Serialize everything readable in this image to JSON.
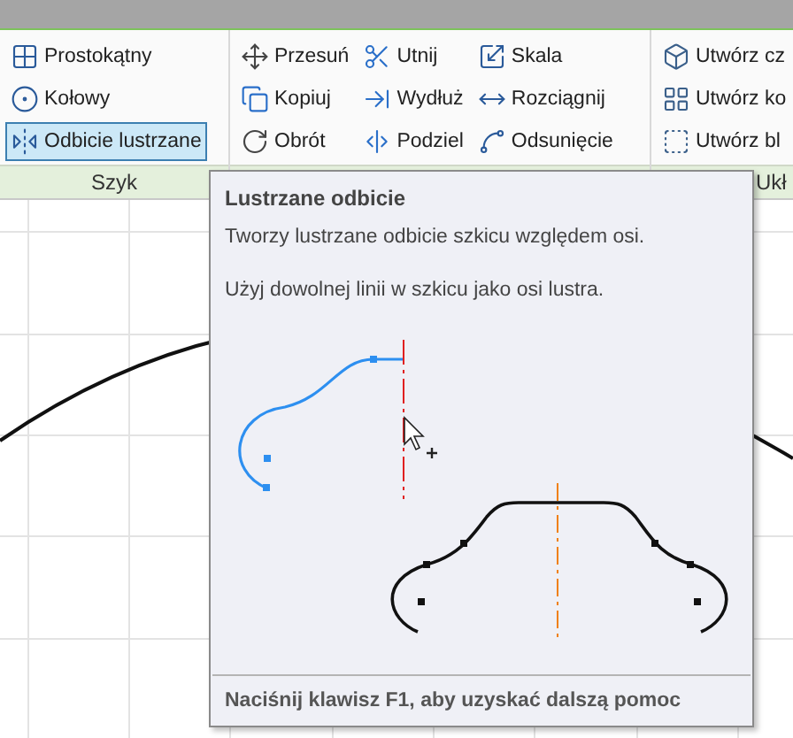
{
  "ribbon": {
    "groups": [
      {
        "label": "Szyk",
        "columns": [
          [
            {
              "label": "Prostokątny",
              "selected": false
            },
            {
              "label": "Kołowy",
              "selected": false
            },
            {
              "label": "Odbicie lustrzane",
              "selected": true
            }
          ]
        ]
      },
      {
        "columns": [
          [
            {
              "label": "Przesuń",
              "selected": false
            },
            {
              "label": "Kopiuj",
              "selected": false
            },
            {
              "label": "Obrót",
              "selected": false
            }
          ],
          [
            {
              "label": "Utnij",
              "selected": false
            },
            {
              "label": "Wydłuż",
              "selected": false
            },
            {
              "label": "Podziel",
              "selected": false
            }
          ],
          [
            {
              "label": "Skala",
              "selected": false
            },
            {
              "label": "Rozciągnij",
              "selected": false
            },
            {
              "label": "Odsunięcie",
              "selected": false
            }
          ]
        ]
      },
      {
        "label": "Ukł",
        "columns": [
          [
            {
              "label": "Utwórz cz",
              "selected": false
            },
            {
              "label": "Utwórz ko",
              "selected": false
            },
            {
              "label": "Utwórz bl",
              "selected": false
            }
          ]
        ]
      }
    ]
  },
  "tooltip": {
    "title": "Lustrzane odbicie",
    "description": "Tworzy lustrzane odbicie szkicu względem osi.",
    "hint": "Użyj dowolnej linii w szkicu jako osi lustra.",
    "footer": "Naciśnij klawisz F1, aby uzyskać dalszą pomoc"
  }
}
